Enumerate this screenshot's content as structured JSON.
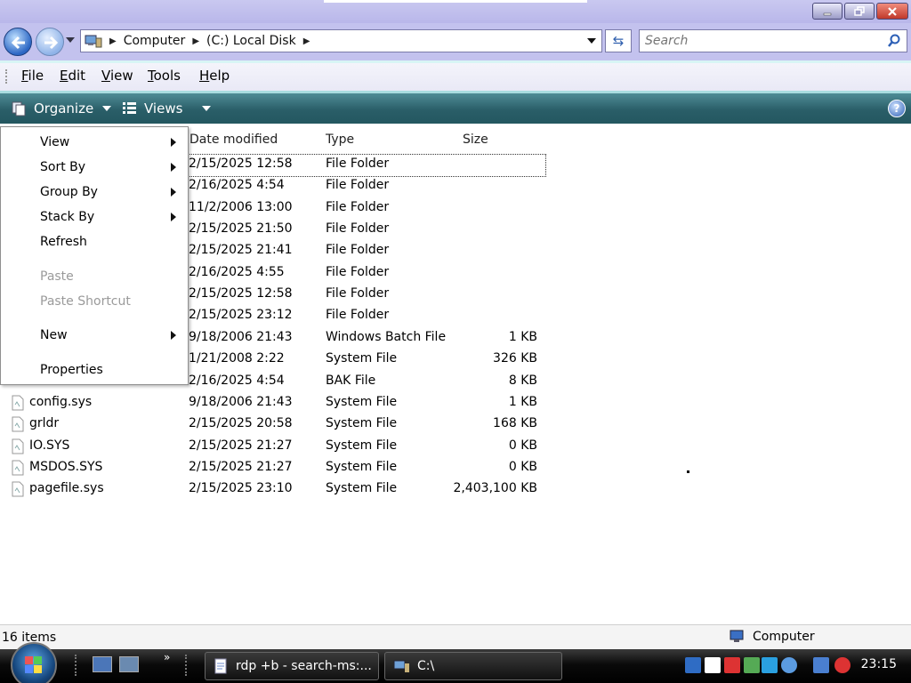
{
  "window": {
    "controls": {
      "minimize": "minimize-icon",
      "maximize": "restore-icon",
      "close": "close-icon"
    }
  },
  "address": {
    "crumbs": [
      "Computer",
      "(C:) Local Disk"
    ],
    "search_placeholder": "Search"
  },
  "menu": {
    "items": [
      {
        "label": "File",
        "u": "F",
        "rest": "ile"
      },
      {
        "label": "Edit",
        "u": "E",
        "rest": "dit"
      },
      {
        "label": "View",
        "u": "V",
        "rest": "iew"
      },
      {
        "label": "Tools",
        "u": "T",
        "rest": "ools"
      },
      {
        "label": "Help",
        "u": "H",
        "rest": "elp"
      }
    ]
  },
  "toolbar": {
    "organize": "Organize",
    "views": "Views",
    "help": "?"
  },
  "columns": {
    "date": "Date modified",
    "type": "Type",
    "size": "Size"
  },
  "files": [
    {
      "name": "",
      "date": "2/15/2025 12:58",
      "type": "File Folder",
      "size": ""
    },
    {
      "name": "",
      "date": "2/16/2025 4:54",
      "type": "File Folder",
      "size": ""
    },
    {
      "name": "",
      "date": "11/2/2006 13:00",
      "type": "File Folder",
      "size": ""
    },
    {
      "name": "",
      "date": "2/15/2025 21:50",
      "type": "File Folder",
      "size": ""
    },
    {
      "name": "",
      "date": "2/15/2025 21:41",
      "type": "File Folder",
      "size": ""
    },
    {
      "name": "",
      "date": "2/16/2025 4:55",
      "type": "File Folder",
      "size": ""
    },
    {
      "name": "",
      "date": "2/15/2025 12:58",
      "type": "File Folder",
      "size": ""
    },
    {
      "name": "",
      "date": "2/15/2025 23:12",
      "type": "File Folder",
      "size": ""
    },
    {
      "name": "",
      "date": "9/18/2006 21:43",
      "type": "Windows Batch File",
      "size": "1 KB"
    },
    {
      "name": "",
      "date": "1/21/2008 2:22",
      "type": "System File",
      "size": "326 KB"
    },
    {
      "name": "",
      "date": "2/16/2025 4:54",
      "type": "BAK File",
      "size": "8 KB"
    },
    {
      "name": "config.sys",
      "date": "9/18/2006 21:43",
      "type": "System File",
      "size": "1 KB"
    },
    {
      "name": "grldr",
      "date": "2/15/2025 20:58",
      "type": "System File",
      "size": "168 KB"
    },
    {
      "name": "IO.SYS",
      "date": "2/15/2025 21:27",
      "type": "System File",
      "size": "0 KB"
    },
    {
      "name": "MSDOS.SYS",
      "date": "2/15/2025 21:27",
      "type": "System File",
      "size": "0 KB"
    },
    {
      "name": "pagefile.sys",
      "date": "2/15/2025 23:10",
      "type": "System File",
      "size": "2,403,100 KB"
    }
  ],
  "context_menu": {
    "items": [
      {
        "label": "View",
        "submenu": true,
        "disabled": false
      },
      {
        "label": "Sort By",
        "submenu": true,
        "disabled": false
      },
      {
        "label": "Group By",
        "submenu": true,
        "disabled": false
      },
      {
        "label": "Stack By",
        "submenu": true,
        "disabled": false
      },
      {
        "label": "Refresh",
        "submenu": false,
        "disabled": false
      },
      {
        "label": "Paste",
        "submenu": false,
        "disabled": true
      },
      {
        "label": "Paste Shortcut",
        "submenu": false,
        "disabled": true
      },
      {
        "label": "New",
        "submenu": true,
        "disabled": false
      },
      {
        "label": "Properties",
        "submenu": false,
        "disabled": false
      }
    ]
  },
  "status": {
    "count": "16 items",
    "location": "Computer"
  },
  "taskbar": {
    "tasks": [
      {
        "label": "rdp +b - search-ms:..."
      },
      {
        "label": "C:\\"
      }
    ],
    "clock": "23:15"
  }
}
